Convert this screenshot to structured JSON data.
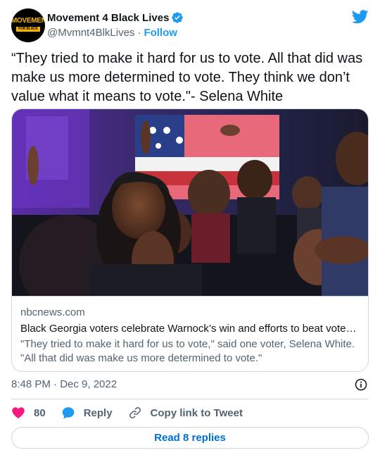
{
  "account": {
    "display_name": "Movement 4 Black Lives",
    "handle": "@Mvmnt4BlkLives",
    "separator": "·",
    "follow_label": "Follow",
    "avatar_text": "MOVEMENT",
    "avatar_subtext": "FOR BLACK LIVES"
  },
  "tweet": {
    "text": "“They tried to make it hard for us to vote. All that did was make us more determined to vote. They think we don’t value what it means to vote.\"- Selena White",
    "timestamp": "8:48 PM · Dec 9, 2022"
  },
  "card": {
    "domain": "nbcnews.com",
    "title": "Black Georgia voters celebrate Warnock’s win and efforts to beat voter …",
    "description": "\"They tried to make it hard for us to vote,\" said one voter, Selena White. \"All that did was make us more determined to vote.\""
  },
  "actions": {
    "like_count": "80",
    "reply_label": "Reply",
    "copy_link_label": "Copy link to Tweet"
  },
  "replies_button": {
    "label": "Read 8 replies"
  },
  "colors": {
    "accent": "#1d9bf0",
    "like": "#f91880",
    "link": "#006fd6",
    "border": "#cfd9de",
    "muted": "#536471"
  },
  "icons": [
    "verified-badge-icon",
    "twitter-bird-icon",
    "info-icon",
    "heart-icon",
    "reply-bubble-icon",
    "link-icon"
  ]
}
